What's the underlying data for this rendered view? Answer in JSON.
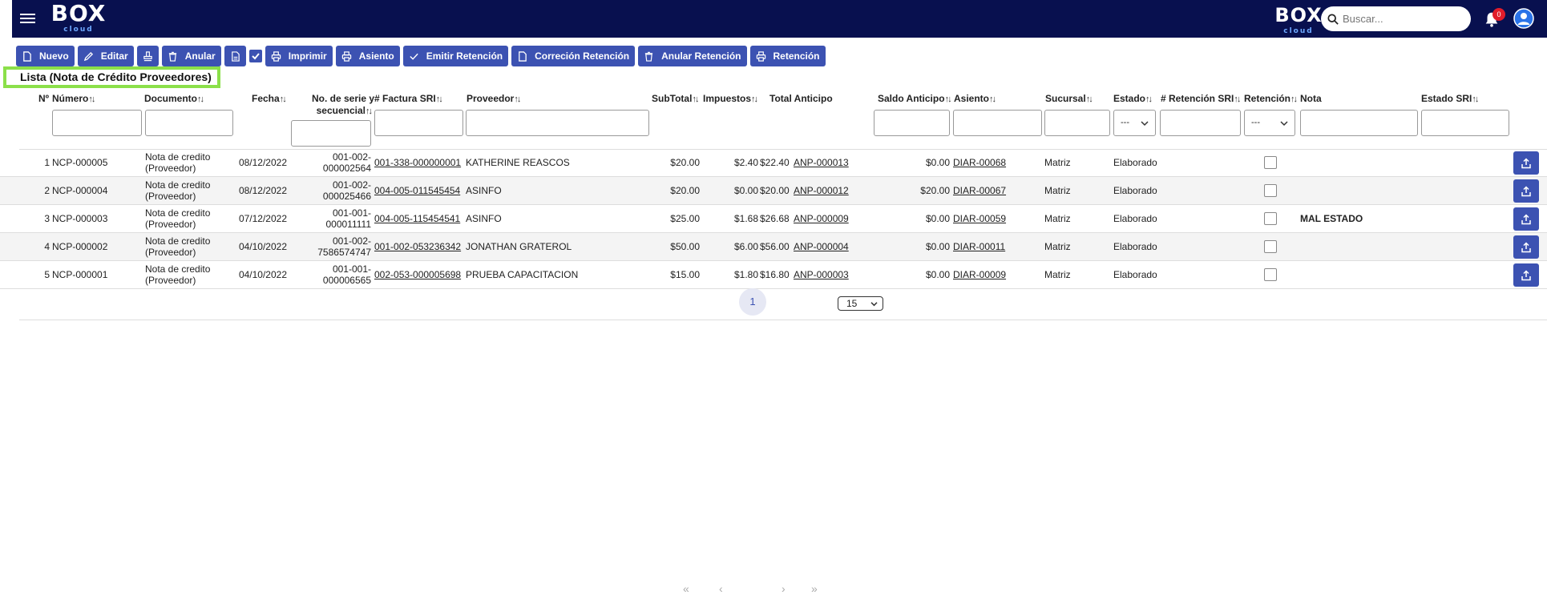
{
  "brand": {
    "logo_text": "BOX",
    "logo_sub": "cloud"
  },
  "header": {
    "search_placeholder": "Buscar...",
    "notifications_count": "0"
  },
  "toolbar": {
    "nuevo": "Nuevo",
    "editar": "Editar",
    "anular": "Anular",
    "imprimir": "Imprimir",
    "asiento": "Asiento",
    "emitir_retencion": "Emitir Retención",
    "correcion_retencion": "Correción Retención",
    "anular_retencion": "Anular Retención",
    "retencion": "Retención"
  },
  "list_title": "Lista (Nota de Crédito Proveedores)",
  "columns": {
    "no": "Nº",
    "numero": "Número",
    "documento": "Documento",
    "fecha": "Fecha",
    "serie_1": "No. de serie y",
    "serie_2": "secuencial",
    "factura": "# Factura SRI",
    "proveedor": "Proveedor",
    "subtotal": "SubTotal",
    "impuestos": "Impuestos",
    "total_anticipo": "Total Anticipo",
    "saldo_anticipo": "Saldo Anticipo",
    "asiento": "Asiento",
    "sucursal": "Sucursal",
    "estado": "Estado",
    "retencion_sri": "# Retención SRI",
    "retencion": "Retención",
    "nota": "Nota",
    "estado_sri": "Estado SRI"
  },
  "filters": {
    "estado_select": "---",
    "retencion_select": "---"
  },
  "rows": [
    {
      "no": "1",
      "numero": "NCP-000005",
      "doc1": "Nota de credito",
      "doc2": "(Proveedor)",
      "fecha": "08/12/2022",
      "serie1": "001-002-",
      "serie2": "000002564",
      "factura": "001-338-000000001",
      "proveedor": "KATHERINE REASCOS",
      "subtotal": "$20.00",
      "impuestos": "$2.40",
      "total": "$22.40",
      "anticipo": "ANP-000013",
      "saldo": "$0.00",
      "asiento": "DIAR-00068",
      "sucursal": "Matriz",
      "estado": "Elaborado",
      "nota": ""
    },
    {
      "no": "2",
      "numero": "NCP-000004",
      "doc1": "Nota de credito",
      "doc2": "(Proveedor)",
      "fecha": "08/12/2022",
      "serie1": "001-002-",
      "serie2": "000025466",
      "factura": "004-005-011545454",
      "proveedor": "ASINFO",
      "subtotal": "$20.00",
      "impuestos": "$0.00",
      "total": "$20.00",
      "anticipo": "ANP-000012",
      "saldo": "$20.00",
      "asiento": "DIAR-00067",
      "sucursal": "Matriz",
      "estado": "Elaborado",
      "nota": ""
    },
    {
      "no": "3",
      "numero": "NCP-000003",
      "doc1": "Nota de credito",
      "doc2": "(Proveedor)",
      "fecha": "07/12/2022",
      "serie1": "001-001-",
      "serie2": "000011111",
      "factura": "004-005-115454541",
      "proveedor": "ASINFO",
      "subtotal": "$25.00",
      "impuestos": "$1.68",
      "total": "$26.68",
      "anticipo": "ANP-000009",
      "saldo": "$0.00",
      "asiento": "DIAR-00059",
      "sucursal": "Matriz",
      "estado": "Elaborado",
      "nota": "MAL ESTADO"
    },
    {
      "no": "4",
      "numero": "NCP-000002",
      "doc1": "Nota de credito",
      "doc2": "(Proveedor)",
      "fecha": "04/10/2022",
      "serie1": "001-002-",
      "serie2": "7586574747",
      "factura": "001-002-053236342",
      "proveedor": "JONATHAN GRATEROL",
      "subtotal": "$50.00",
      "impuestos": "$6.00",
      "total": "$56.00",
      "anticipo": "ANP-000004",
      "saldo": "$0.00",
      "asiento": "DIAR-00011",
      "sucursal": "Matriz",
      "estado": "Elaborado",
      "nota": ""
    },
    {
      "no": "5",
      "numero": "NCP-000001",
      "doc1": "Nota de credito",
      "doc2": "(Proveedor)",
      "fecha": "04/10/2022",
      "serie1": "001-001-",
      "serie2": "000006565",
      "factura": "002-053-000005698",
      "proveedor": "PRUEBA CAPACITACION",
      "subtotal": "$15.00",
      "impuestos": "$1.80",
      "total": "$16.80",
      "anticipo": "ANP-000003",
      "saldo": "$0.00",
      "asiento": "DIAR-00009",
      "sucursal": "Matriz",
      "estado": "Elaborado",
      "nota": ""
    }
  ],
  "pagination": {
    "first": "«",
    "prev": "‹",
    "current": "1",
    "next": "›",
    "last": "»",
    "page_size": "15"
  },
  "colors": {
    "navbar": "#08104f",
    "button": "#3c52b2",
    "highlight": "#8be04a",
    "badge": "#e11d2b"
  },
  "icons": [
    "menu-icon",
    "search-icon",
    "bell-icon",
    "user-icon",
    "file-icon",
    "pencil-icon",
    "stamp-icon",
    "trash-icon",
    "document-icon",
    "check-icon",
    "printer-icon",
    "upload-icon"
  ]
}
